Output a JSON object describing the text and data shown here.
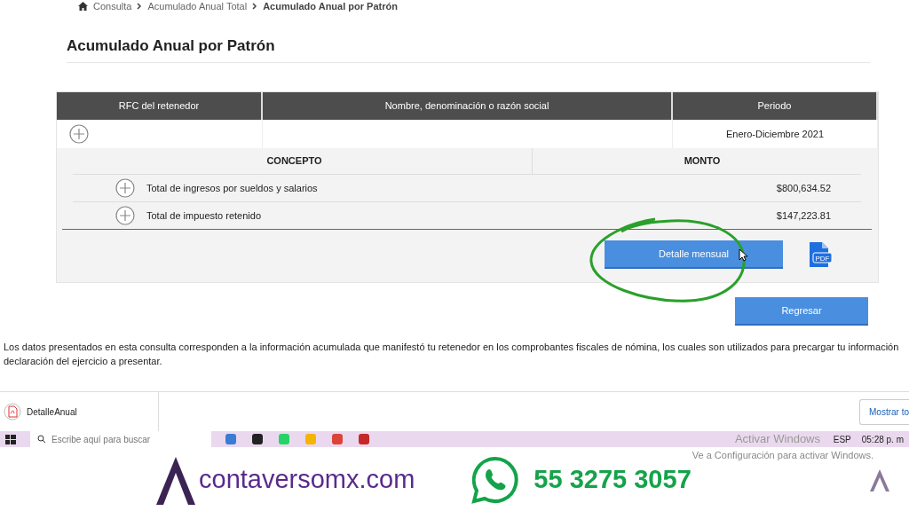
{
  "breadcrumb": [
    {
      "label": "Consulta",
      "current": false
    },
    {
      "label": "Acumulado Anual Total",
      "current": false
    },
    {
      "label": "Acumulado Anual por Patrón",
      "current": true
    }
  ],
  "title": "Acumulado Anual por Patrón",
  "table": {
    "columns": [
      "RFC del retenedor",
      "Nombre, denominación o razón social",
      "Periodo"
    ],
    "row": {
      "expanded": false,
      "periodo": "Enero-Diciembre 2021"
    },
    "detail": {
      "columns": [
        "CONCEPTO",
        "MONTO"
      ],
      "rows": [
        {
          "concepto": "Total de ingresos por sueldos y salarios",
          "monto": "$800,634.52",
          "expanded": false
        },
        {
          "concepto": "Total de impuesto retenido",
          "monto": "$147,223.81",
          "expanded": false
        }
      ]
    }
  },
  "buttons": {
    "detail": "Detalle mensual",
    "pdf": "PDF",
    "back": "Regresar"
  },
  "note": "Los datos presentados en esta consulta corresponden a la información acumulada que manifestó tu retenedor en los comprobantes fiscales de nómina, los cuales son utilizados para precargar tu información\ndeclaración del ejercicio a presentar.",
  "download_bar": {
    "file": "DetalleAnual",
    "show_all": "Mostrar to"
  },
  "taskbar": {
    "search_placeholder": "Escribe aquí para buscar",
    "language": "ESP",
    "time": "05:28 p. m"
  },
  "activation": {
    "title": "Activar Windows",
    "text": "Ve a Configuración para activar Windows."
  },
  "banner": {
    "site": "contaversomx.com",
    "phone": "55 3275 3057"
  }
}
